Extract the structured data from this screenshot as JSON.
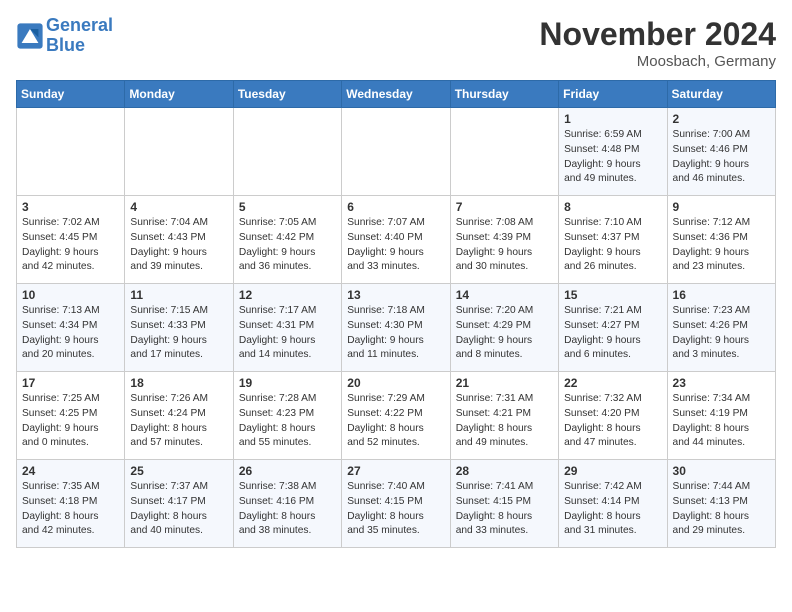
{
  "header": {
    "logo_line1": "General",
    "logo_line2": "Blue",
    "month_title": "November 2024",
    "location": "Moosbach, Germany"
  },
  "days_of_week": [
    "Sunday",
    "Monday",
    "Tuesday",
    "Wednesday",
    "Thursday",
    "Friday",
    "Saturday"
  ],
  "weeks": [
    [
      {
        "day": "",
        "info": ""
      },
      {
        "day": "",
        "info": ""
      },
      {
        "day": "",
        "info": ""
      },
      {
        "day": "",
        "info": ""
      },
      {
        "day": "",
        "info": ""
      },
      {
        "day": "1",
        "info": "Sunrise: 6:59 AM\nSunset: 4:48 PM\nDaylight: 9 hours\nand 49 minutes."
      },
      {
        "day": "2",
        "info": "Sunrise: 7:00 AM\nSunset: 4:46 PM\nDaylight: 9 hours\nand 46 minutes."
      }
    ],
    [
      {
        "day": "3",
        "info": "Sunrise: 7:02 AM\nSunset: 4:45 PM\nDaylight: 9 hours\nand 42 minutes."
      },
      {
        "day": "4",
        "info": "Sunrise: 7:04 AM\nSunset: 4:43 PM\nDaylight: 9 hours\nand 39 minutes."
      },
      {
        "day": "5",
        "info": "Sunrise: 7:05 AM\nSunset: 4:42 PM\nDaylight: 9 hours\nand 36 minutes."
      },
      {
        "day": "6",
        "info": "Sunrise: 7:07 AM\nSunset: 4:40 PM\nDaylight: 9 hours\nand 33 minutes."
      },
      {
        "day": "7",
        "info": "Sunrise: 7:08 AM\nSunset: 4:39 PM\nDaylight: 9 hours\nand 30 minutes."
      },
      {
        "day": "8",
        "info": "Sunrise: 7:10 AM\nSunset: 4:37 PM\nDaylight: 9 hours\nand 26 minutes."
      },
      {
        "day": "9",
        "info": "Sunrise: 7:12 AM\nSunset: 4:36 PM\nDaylight: 9 hours\nand 23 minutes."
      }
    ],
    [
      {
        "day": "10",
        "info": "Sunrise: 7:13 AM\nSunset: 4:34 PM\nDaylight: 9 hours\nand 20 minutes."
      },
      {
        "day": "11",
        "info": "Sunrise: 7:15 AM\nSunset: 4:33 PM\nDaylight: 9 hours\nand 17 minutes."
      },
      {
        "day": "12",
        "info": "Sunrise: 7:17 AM\nSunset: 4:31 PM\nDaylight: 9 hours\nand 14 minutes."
      },
      {
        "day": "13",
        "info": "Sunrise: 7:18 AM\nSunset: 4:30 PM\nDaylight: 9 hours\nand 11 minutes."
      },
      {
        "day": "14",
        "info": "Sunrise: 7:20 AM\nSunset: 4:29 PM\nDaylight: 9 hours\nand 8 minutes."
      },
      {
        "day": "15",
        "info": "Sunrise: 7:21 AM\nSunset: 4:27 PM\nDaylight: 9 hours\nand 6 minutes."
      },
      {
        "day": "16",
        "info": "Sunrise: 7:23 AM\nSunset: 4:26 PM\nDaylight: 9 hours\nand 3 minutes."
      }
    ],
    [
      {
        "day": "17",
        "info": "Sunrise: 7:25 AM\nSunset: 4:25 PM\nDaylight: 9 hours\nand 0 minutes."
      },
      {
        "day": "18",
        "info": "Sunrise: 7:26 AM\nSunset: 4:24 PM\nDaylight: 8 hours\nand 57 minutes."
      },
      {
        "day": "19",
        "info": "Sunrise: 7:28 AM\nSunset: 4:23 PM\nDaylight: 8 hours\nand 55 minutes."
      },
      {
        "day": "20",
        "info": "Sunrise: 7:29 AM\nSunset: 4:22 PM\nDaylight: 8 hours\nand 52 minutes."
      },
      {
        "day": "21",
        "info": "Sunrise: 7:31 AM\nSunset: 4:21 PM\nDaylight: 8 hours\nand 49 minutes."
      },
      {
        "day": "22",
        "info": "Sunrise: 7:32 AM\nSunset: 4:20 PM\nDaylight: 8 hours\nand 47 minutes."
      },
      {
        "day": "23",
        "info": "Sunrise: 7:34 AM\nSunset: 4:19 PM\nDaylight: 8 hours\nand 44 minutes."
      }
    ],
    [
      {
        "day": "24",
        "info": "Sunrise: 7:35 AM\nSunset: 4:18 PM\nDaylight: 8 hours\nand 42 minutes."
      },
      {
        "day": "25",
        "info": "Sunrise: 7:37 AM\nSunset: 4:17 PM\nDaylight: 8 hours\nand 40 minutes."
      },
      {
        "day": "26",
        "info": "Sunrise: 7:38 AM\nSunset: 4:16 PM\nDaylight: 8 hours\nand 38 minutes."
      },
      {
        "day": "27",
        "info": "Sunrise: 7:40 AM\nSunset: 4:15 PM\nDaylight: 8 hours\nand 35 minutes."
      },
      {
        "day": "28",
        "info": "Sunrise: 7:41 AM\nSunset: 4:15 PM\nDaylight: 8 hours\nand 33 minutes."
      },
      {
        "day": "29",
        "info": "Sunrise: 7:42 AM\nSunset: 4:14 PM\nDaylight: 8 hours\nand 31 minutes."
      },
      {
        "day": "30",
        "info": "Sunrise: 7:44 AM\nSunset: 4:13 PM\nDaylight: 8 hours\nand 29 minutes."
      }
    ]
  ]
}
